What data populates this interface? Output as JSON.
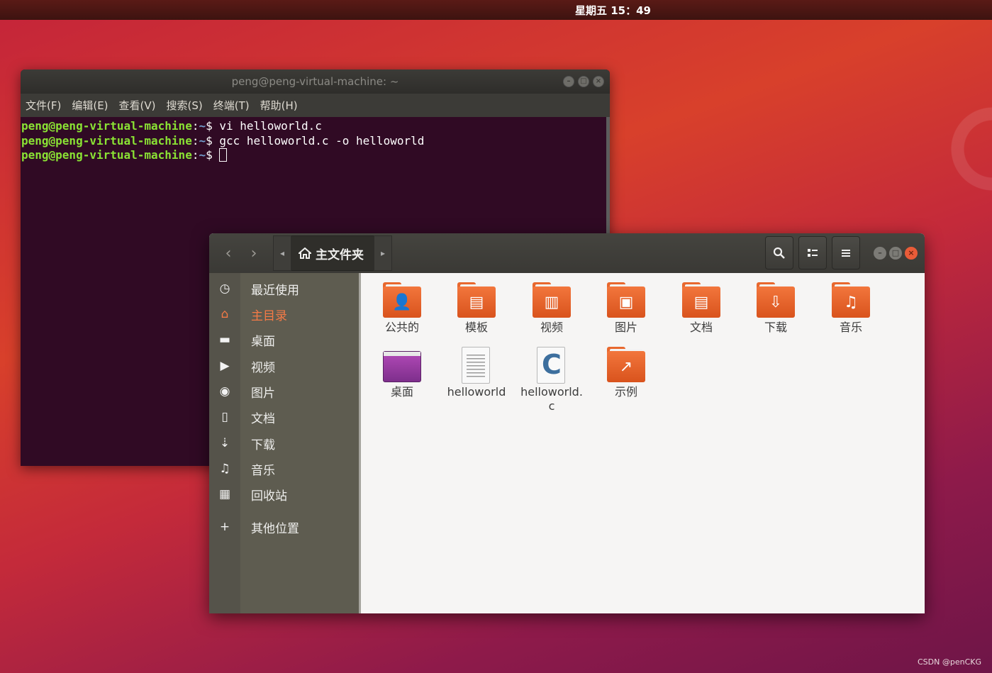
{
  "topbar": {
    "clock": "星期五 15：49"
  },
  "terminal": {
    "title": "peng@peng-virtual-machine: ~",
    "menu": [
      "文件(F)",
      "编辑(E)",
      "查看(V)",
      "搜索(S)",
      "终端(T)",
      "帮助(H)"
    ],
    "lines": [
      {
        "user": "peng@peng-virtual-machine",
        "sep": ":",
        "path": "~",
        "dollar": "$ ",
        "cmd": "vi helloworld.c"
      },
      {
        "user": "peng@peng-virtual-machine",
        "sep": ":",
        "path": "~",
        "dollar": "$ ",
        "cmd": "gcc helloworld.c -o helloworld"
      },
      {
        "user": "peng@peng-virtual-machine",
        "sep": ":",
        "path": "~",
        "dollar": "$ ",
        "cmd": ""
      }
    ],
    "window_buttons": {
      "minimize": "–",
      "maximize": "□",
      "close": "×"
    }
  },
  "files": {
    "path_current": "主文件夹",
    "nav": {
      "back": "‹",
      "forward": "›",
      "path_left": "◂",
      "path_right": "▸"
    },
    "header_icons": {
      "search": "search-icon",
      "view": "list-view-icon",
      "menu": "hamburger-menu-icon"
    },
    "sidebar": [
      {
        "label": "最近使用",
        "icon": "recent-clock-icon",
        "glyph": "◷"
      },
      {
        "label": "主目录",
        "icon": "home-icon",
        "glyph": "⌂",
        "active": true
      },
      {
        "label": "桌面",
        "icon": "desktop-folder-icon",
        "glyph": "▬"
      },
      {
        "label": "视频",
        "icon": "video-camera-icon",
        "glyph": "▶"
      },
      {
        "label": "图片",
        "icon": "camera-icon",
        "glyph": "◉"
      },
      {
        "label": "文档",
        "icon": "document-icon",
        "glyph": "▯"
      },
      {
        "label": "下载",
        "icon": "download-arrow-icon",
        "glyph": "⇣"
      },
      {
        "label": "音乐",
        "icon": "music-note-icon",
        "glyph": "♫"
      },
      {
        "label": "回收站",
        "icon": "trash-icon",
        "glyph": "▦"
      },
      {
        "label": "其他位置",
        "icon": "plus-icon",
        "glyph": "+"
      }
    ],
    "items": [
      {
        "label": "公共的",
        "type": "folder",
        "emblem": "👤"
      },
      {
        "label": "模板",
        "type": "folder",
        "emblem": "▤"
      },
      {
        "label": "视频",
        "type": "folder",
        "emblem": "▥"
      },
      {
        "label": "图片",
        "type": "folder",
        "emblem": "▣"
      },
      {
        "label": "文档",
        "type": "folder",
        "emblem": "▤"
      },
      {
        "label": "下载",
        "type": "folder",
        "emblem": "⇩"
      },
      {
        "label": "音乐",
        "type": "folder",
        "emblem": "♫"
      },
      {
        "label": "桌面",
        "type": "desktop"
      },
      {
        "label": "helloworld",
        "type": "file"
      },
      {
        "label": "helloworld.\nc",
        "type": "cfile"
      },
      {
        "label": "示例",
        "type": "folder-link",
        "emblem": "↗"
      }
    ]
  },
  "watermark": "CSDN @penCKG",
  "colors": {
    "accent": "#e95420",
    "terminal_bg": "#300a24",
    "prompt_user": "#8ae234",
    "prompt_path": "#729fcf"
  }
}
